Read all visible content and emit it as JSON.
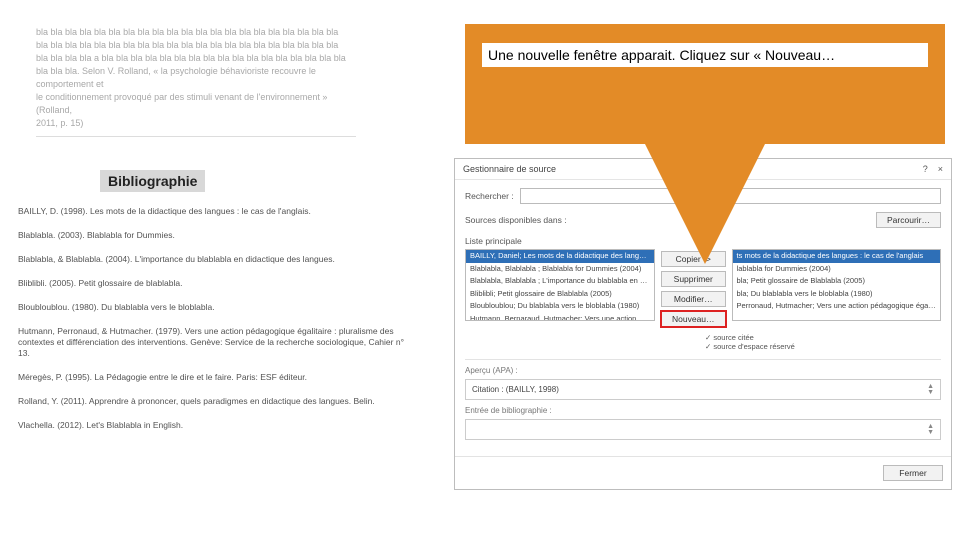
{
  "snippet": {
    "l1": "bla bla bla bla bla bla bla bla bla bla bla bla bla bla bla bla bla bla bla bla bla",
    "l2": "bla bla bla bla bla bla bla bla bla bla bla bla bla bla bla bla bla bla bla bla bla",
    "l3": "bla bla bla bla a bla bla bla bla bla bla bla bla bla bla bla bla bla bla bla bla bla",
    "l4": "bla bla bla. Selon V. Rolland, « la psychologie béhavioriste recouvre le comportement et",
    "l5": "le conditionnement provoqué par des stimuli venant de l'environnement » (Rolland,",
    "l6": "2011, p. 15)"
  },
  "biblio": {
    "heading": "Bibliographie",
    "items": [
      "BAILLY, D. (1998). Les mots de la didactique des langues : le cas de l'anglais.",
      "Blablabla. (2003). Blablabla for Dummies.",
      "Blablabla, & Blablabla. (2004). L'importance du blablabla en didactique des langues.",
      "Bliblibli. (2005). Petit glossaire de blablabla.",
      "Bloubloublou. (1980). Du blablabla vers le bloblabla.",
      "Hutmann, Perronaud, & Hutmacher. (1979). Vers une action pédagogique égalitaire : pluralisme des contextes et différenciation des interventions. Genève: Service de la recherche sociologique, Cahier n° 13.",
      "Méregès, P. (1995). La Pédagogie entre le dire et le faire. Paris: ESF éditeur.",
      "Rolland, Y. (2011). Apprendre à prononcer, quels paradigmes en didactique des langues. Belin.",
      "Vlachella. (2012). Let's Blablabla in English."
    ]
  },
  "callout": {
    "text": "Une nouvelle fenêtre apparait. Cliquez sur « Nouveau…"
  },
  "dialog": {
    "title": "Gestionnaire de source",
    "help": "?",
    "close": "×",
    "search_label": "Rechercher :",
    "sources_label": "Sources disponibles dans :",
    "browse": "Parcourir…",
    "master_list": "Liste principale",
    "left_list": [
      "BAILLY, Daniel; Les mots de la didactique des langues : le cas de l'anglais",
      "Blablabla, Blablabla ; Blablabla for Dummies (2004)",
      "Blablabla, Blablabla ; L'importance du blablabla en didactique des lang…",
      "Bliblibli; Petit glossaire de Blablabla (2005)",
      "Bloubloublou; Du blablabla vers le bloblabla (1980)",
      "Hutmann, Bernaraud, Hutmacher; Vers une action pédagogique égalitaire"
    ],
    "right_list": [
      "ts mots de la didactique des langues : le cas de l'anglais",
      "lablabla for Dummies (2004)",
      "bla; Petit glossaire de Blablabla (2005)",
      "bla; Du blablabla vers le bloblabla (1980)",
      "Perronaud, Hutmacher; Vers une action pédagogique égalitaire"
    ],
    "btn_copy": "Copier ->",
    "btn_delete": "Supprimer",
    "btn_edit": "Modifier…",
    "btn_new": "Nouveau…",
    "legend1": "source citée",
    "legend2": "source d'espace réservé",
    "preview_label": "Aperçu (APA) :",
    "citation": "Citation : (BAILLY, 1998)",
    "entry_label": "Entrée de bibliographie :",
    "close_btn": "Fermer"
  }
}
